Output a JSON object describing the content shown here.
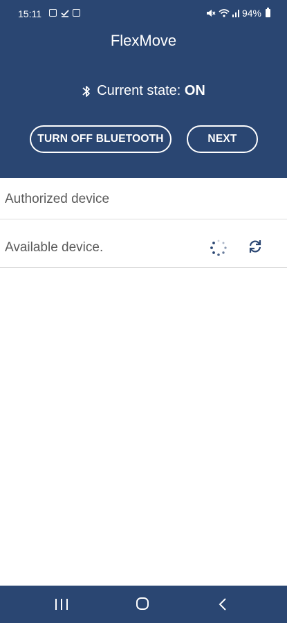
{
  "status_bar": {
    "time": "15:11",
    "battery_percent": "94%",
    "left_icons": [
      "gallery-icon",
      "download-done-icon",
      "sim-icon"
    ],
    "right_icons": [
      "mute-icon",
      "wifi-icon",
      "signal-icon",
      "battery-icon"
    ]
  },
  "header": {
    "title": "FlexMove",
    "state_label": "Current state: ",
    "state_value": "ON",
    "turn_off_button": "TURN OFF BLUETOOTH",
    "next_button": "NEXT"
  },
  "sections": {
    "authorized_label": "Authorized device",
    "available_label": "Available device."
  },
  "colors": {
    "primary": "#2a4672",
    "background": "#ffffff",
    "label_text": "#5a5a5a",
    "divider": "#dcdcdc"
  },
  "navigation_bar": {
    "icons": [
      "recent-apps-icon",
      "home-icon",
      "back-icon"
    ]
  }
}
